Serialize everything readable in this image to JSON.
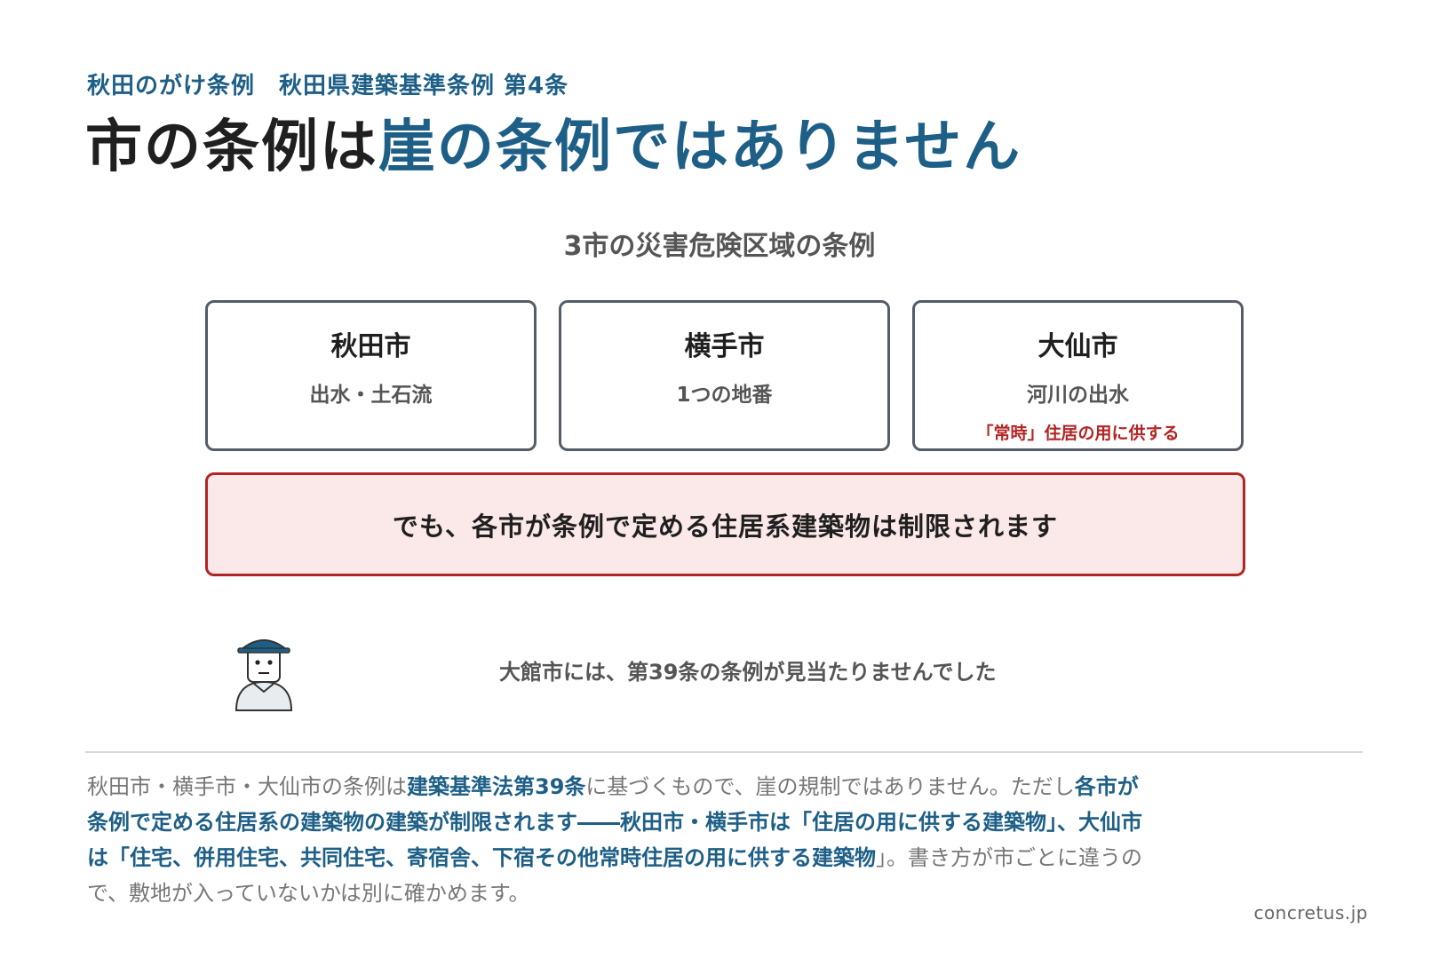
{
  "header": {
    "subtitle": "秋田のがけ条例　秋田県建築基準条例 第4条",
    "title_dark": "市の条例は",
    "title_blue": "崖の条例ではありません"
  },
  "section_heading": "3市の災害危険区域の条例",
  "cities": [
    {
      "name": "秋田市",
      "scope": "出水・土石流",
      "note": ""
    },
    {
      "name": "横手市",
      "scope": "1つの地番",
      "note": ""
    },
    {
      "name": "大仙市",
      "scope": "河川の出水",
      "note": "「常時」住居の用に供する"
    }
  ],
  "alert": "でも、各市が条例で定める住居系建築物は制限されます",
  "remark": "大館市には、第39条の条例が見当たりませんでした",
  "explanation": {
    "p1": "秋田市・横手市・大仙市の条例は",
    "p2": "建築基準法第39条",
    "p3": "に基づくもので、崖の規制ではありません。ただし",
    "p4": "各市が条例で定める住居系の建築物の建築が制限されます――秋田市・横手市は「住居の用に供する建築物」、大仙市は「住宅、併用住宅、共同住宅、寄宿舎、下宿その他常時住居の用に供する建築物",
    "p5": "」。書き方が市ごとに違うので、敷地が入っていないかは別に確かめます。"
  },
  "credit": "concretus.jp",
  "colors": {
    "accent_blue": "#1d5f86",
    "alert_red": "#b32424",
    "alert_bg": "#fbe8e8",
    "card_border": "#555c66"
  },
  "icons": {
    "avatar": "person-with-cap-icon"
  }
}
